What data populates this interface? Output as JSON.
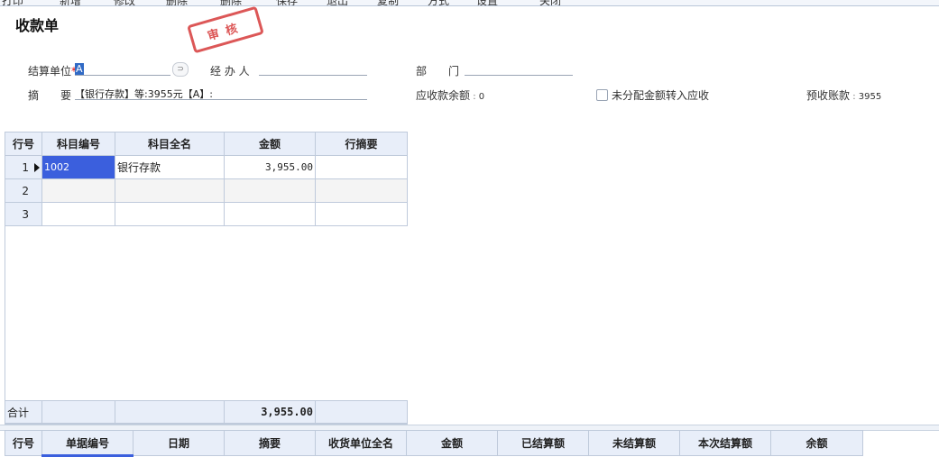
{
  "toolbar": {
    "items": [
      "打印",
      "新增",
      "修改",
      "删除",
      "删除",
      "保存",
      "退出",
      "复制",
      "方式",
      "设置",
      "关闭"
    ]
  },
  "form": {
    "title": "收款单",
    "stamp": "审核",
    "settle_unit_label": "结算单位",
    "settle_unit_required": "*",
    "settle_unit_value": "A",
    "handler_label": "经 办 人",
    "dept_label": "部　　门",
    "summary_label": "摘　　要",
    "summary_value": "【银行存款】等:3955元【A】:",
    "receivable_balance_label": "应收款余额",
    "receivable_balance_value": "0",
    "unallocated_label": "未分配金额转入应收",
    "prepaid_label": "预收账款",
    "prepaid_value": "3955"
  },
  "grid1": {
    "columns": [
      "行号",
      "科目编号",
      "科目全名",
      "金额",
      "行摘要"
    ],
    "rows": [
      {
        "no": "1",
        "code": "1002",
        "name": "银行存款",
        "amount": "3,955.00",
        "memo": ""
      },
      {
        "no": "2",
        "code": "",
        "name": "",
        "amount": "",
        "memo": ""
      },
      {
        "no": "3",
        "code": "",
        "name": "",
        "amount": "",
        "memo": ""
      }
    ],
    "total_label": "合计",
    "total_amount": "3,955.00"
  },
  "grid2": {
    "columns": [
      "行号",
      "单据编号",
      "日期",
      "摘要",
      "收货单位全名",
      "金额",
      "已结算额",
      "未结算额",
      "本次结算额",
      "余额"
    ]
  },
  "colors": {
    "selected_cell": "#3b5fdd",
    "header_bg": "#e8eef9",
    "stamp": "#d63a3a",
    "grid_border": "#bfcadb"
  }
}
